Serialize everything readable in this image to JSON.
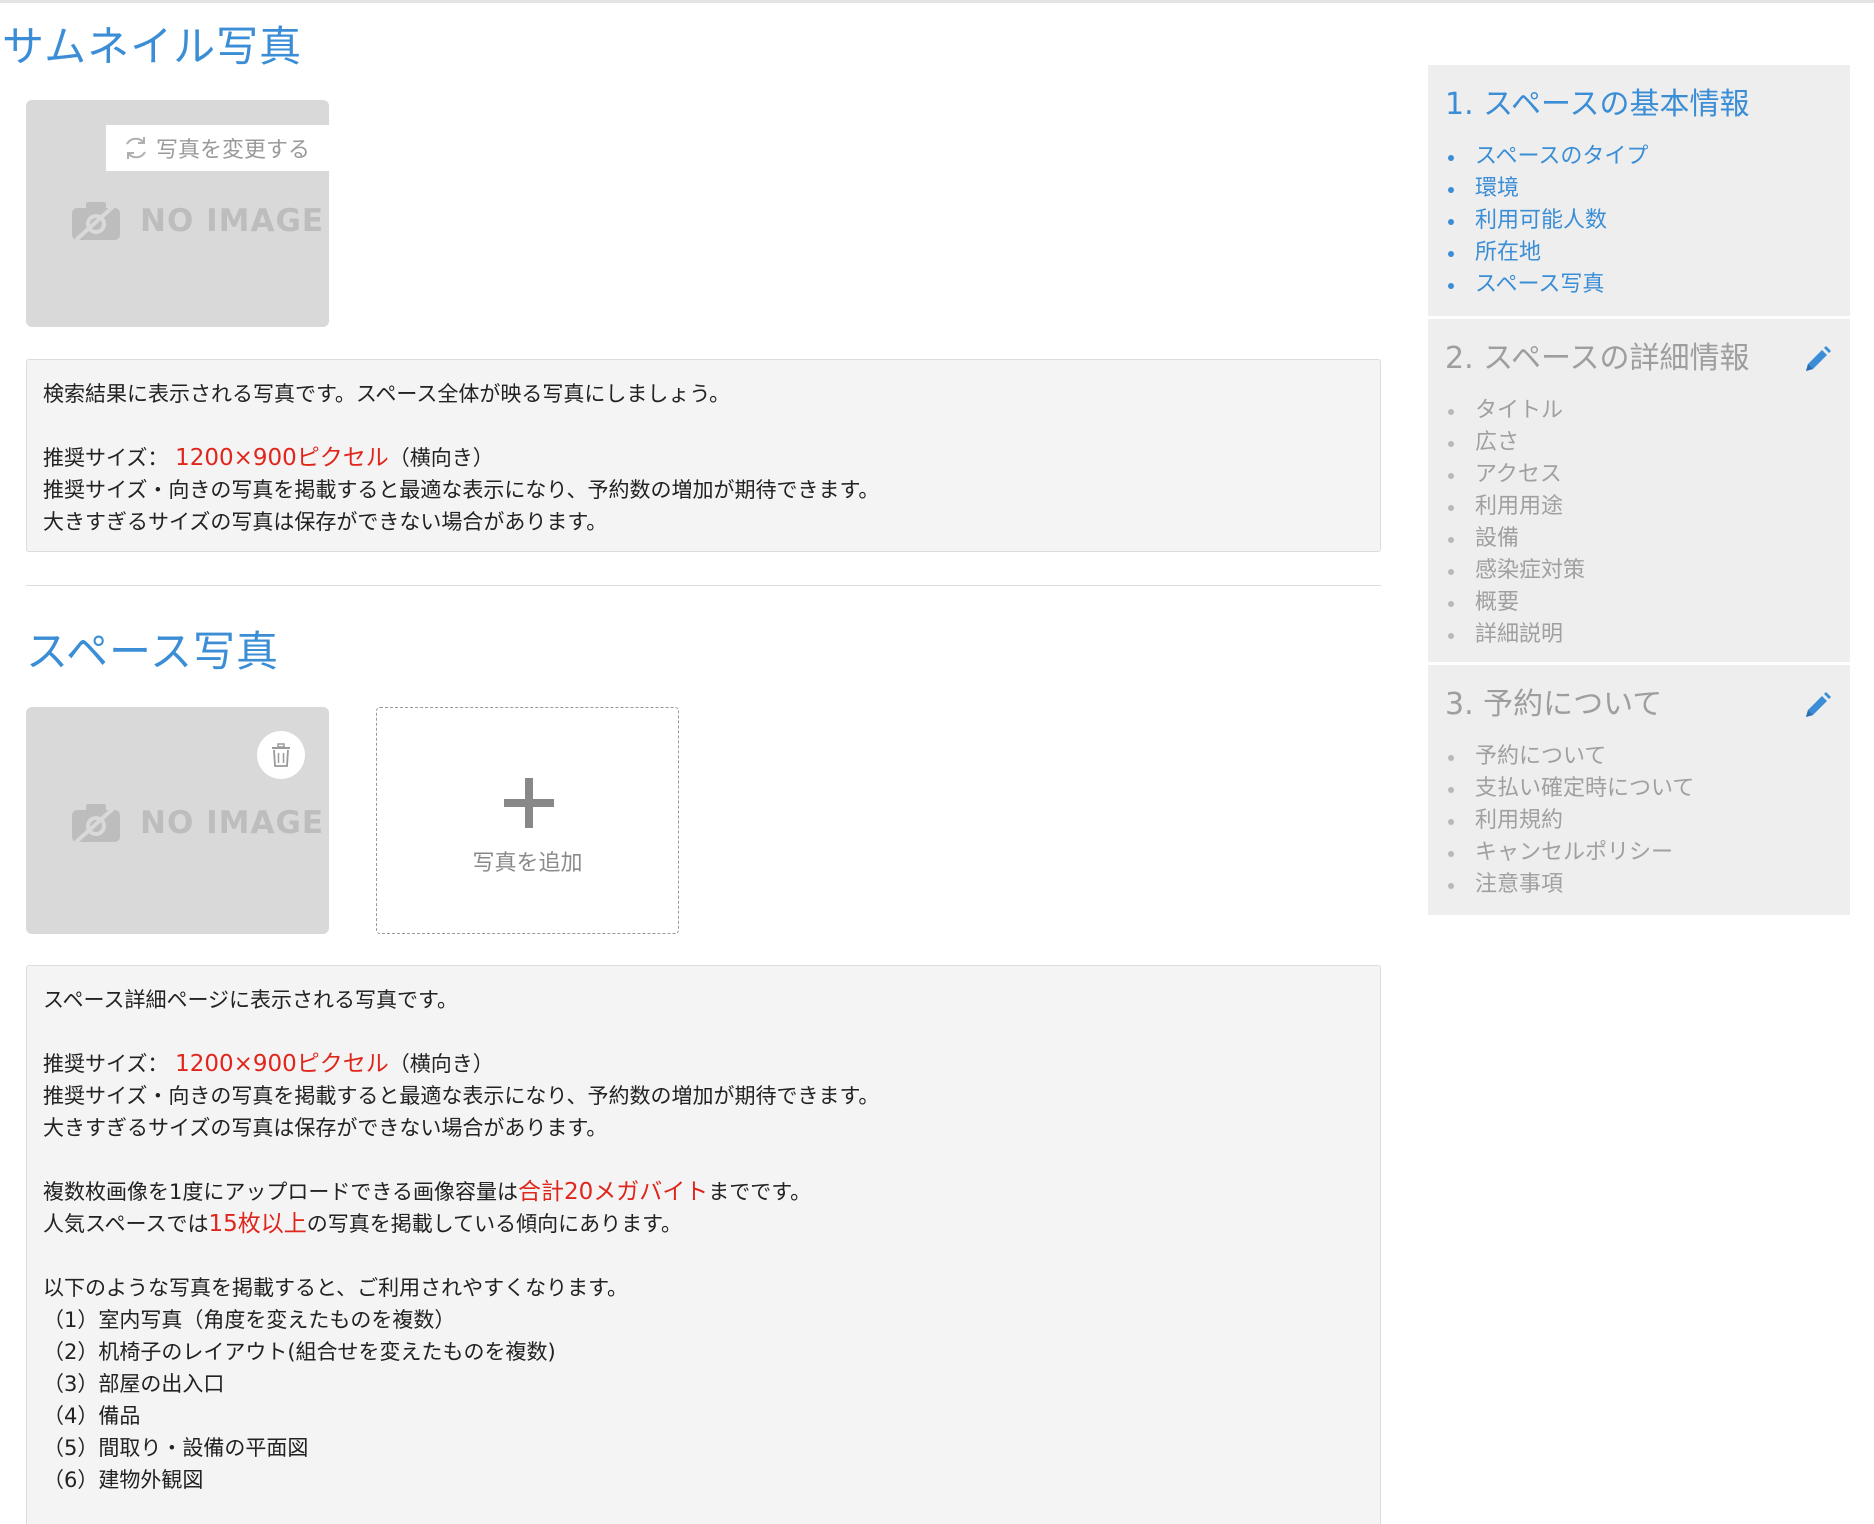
{
  "thumbnail": {
    "title": "サムネイル写真",
    "change_button": "写真を変更する",
    "no_image": "NO IMAGE",
    "info": {
      "line1": "検索結果に表示される写真です。スペース全体が映る写真にしましょう。",
      "size_label": "推奨サイズ：",
      "size_value": "1200×900ピクセル",
      "size_suffix": "（横向き）",
      "line3": "推奨サイズ・向きの写真を掲載すると最適な表示になり、予約数の増加が期待できます。",
      "line4": "大きすぎるサイズの写真は保存ができない場合があります。"
    }
  },
  "space_photos": {
    "title": "スペース写真",
    "no_image": "NO IMAGE",
    "add_label": "写真を追加",
    "info": {
      "line1": "スペース詳細ページに表示される写真です。",
      "size_label": "推奨サイズ：",
      "size_value": "1200×900ピクセル",
      "size_suffix": "（横向き）",
      "line3": "推奨サイズ・向きの写真を掲載すると最適な表示になり、予約数の増加が期待できます。",
      "line4": "大きすぎるサイズの写真は保存ができない場合があります。",
      "upload_prefix": "複数枚画像を1度にアップロードできる画像容量は",
      "upload_value": "合計20メガバイト",
      "upload_suffix": "までです。",
      "popular_prefix": "人気スペースでは",
      "popular_value": "15枚以上",
      "popular_suffix": "の写真を掲載している傾向にあります。",
      "list_intro": "以下のような写真を掲載すると、ご利用されやすくなります。",
      "list": [
        "（1）室内写真（角度を変えたものを複数）",
        "（2）机椅子のレイアウト(組合せを変えたものを複数)",
        "（3）部屋の出入口",
        "（4）備品",
        "（5）間取り・設備の平面図",
        "（6）建物外観図"
      ]
    }
  },
  "sidebar": {
    "sections": [
      {
        "title": "1. スペースの基本情報",
        "items": [
          "スペースのタイプ",
          "環境",
          "利用可能人数",
          "所在地",
          "スペース写真"
        ]
      },
      {
        "title": "2. スペースの詳細情報",
        "items": [
          "タイトル",
          "広さ",
          "アクセス",
          "利用用途",
          "設備",
          "感染症対策",
          "概要",
          "詳細説明"
        ]
      },
      {
        "title": "3. 予約について",
        "items": [
          "予約について",
          "支払い確定時について",
          "利用規約",
          "キャンセルポリシー",
          "注意事項"
        ]
      }
    ]
  },
  "colors": {
    "accent": "#3b8ed6",
    "highlight": "#e0261c",
    "muted": "#a0a0a0"
  }
}
